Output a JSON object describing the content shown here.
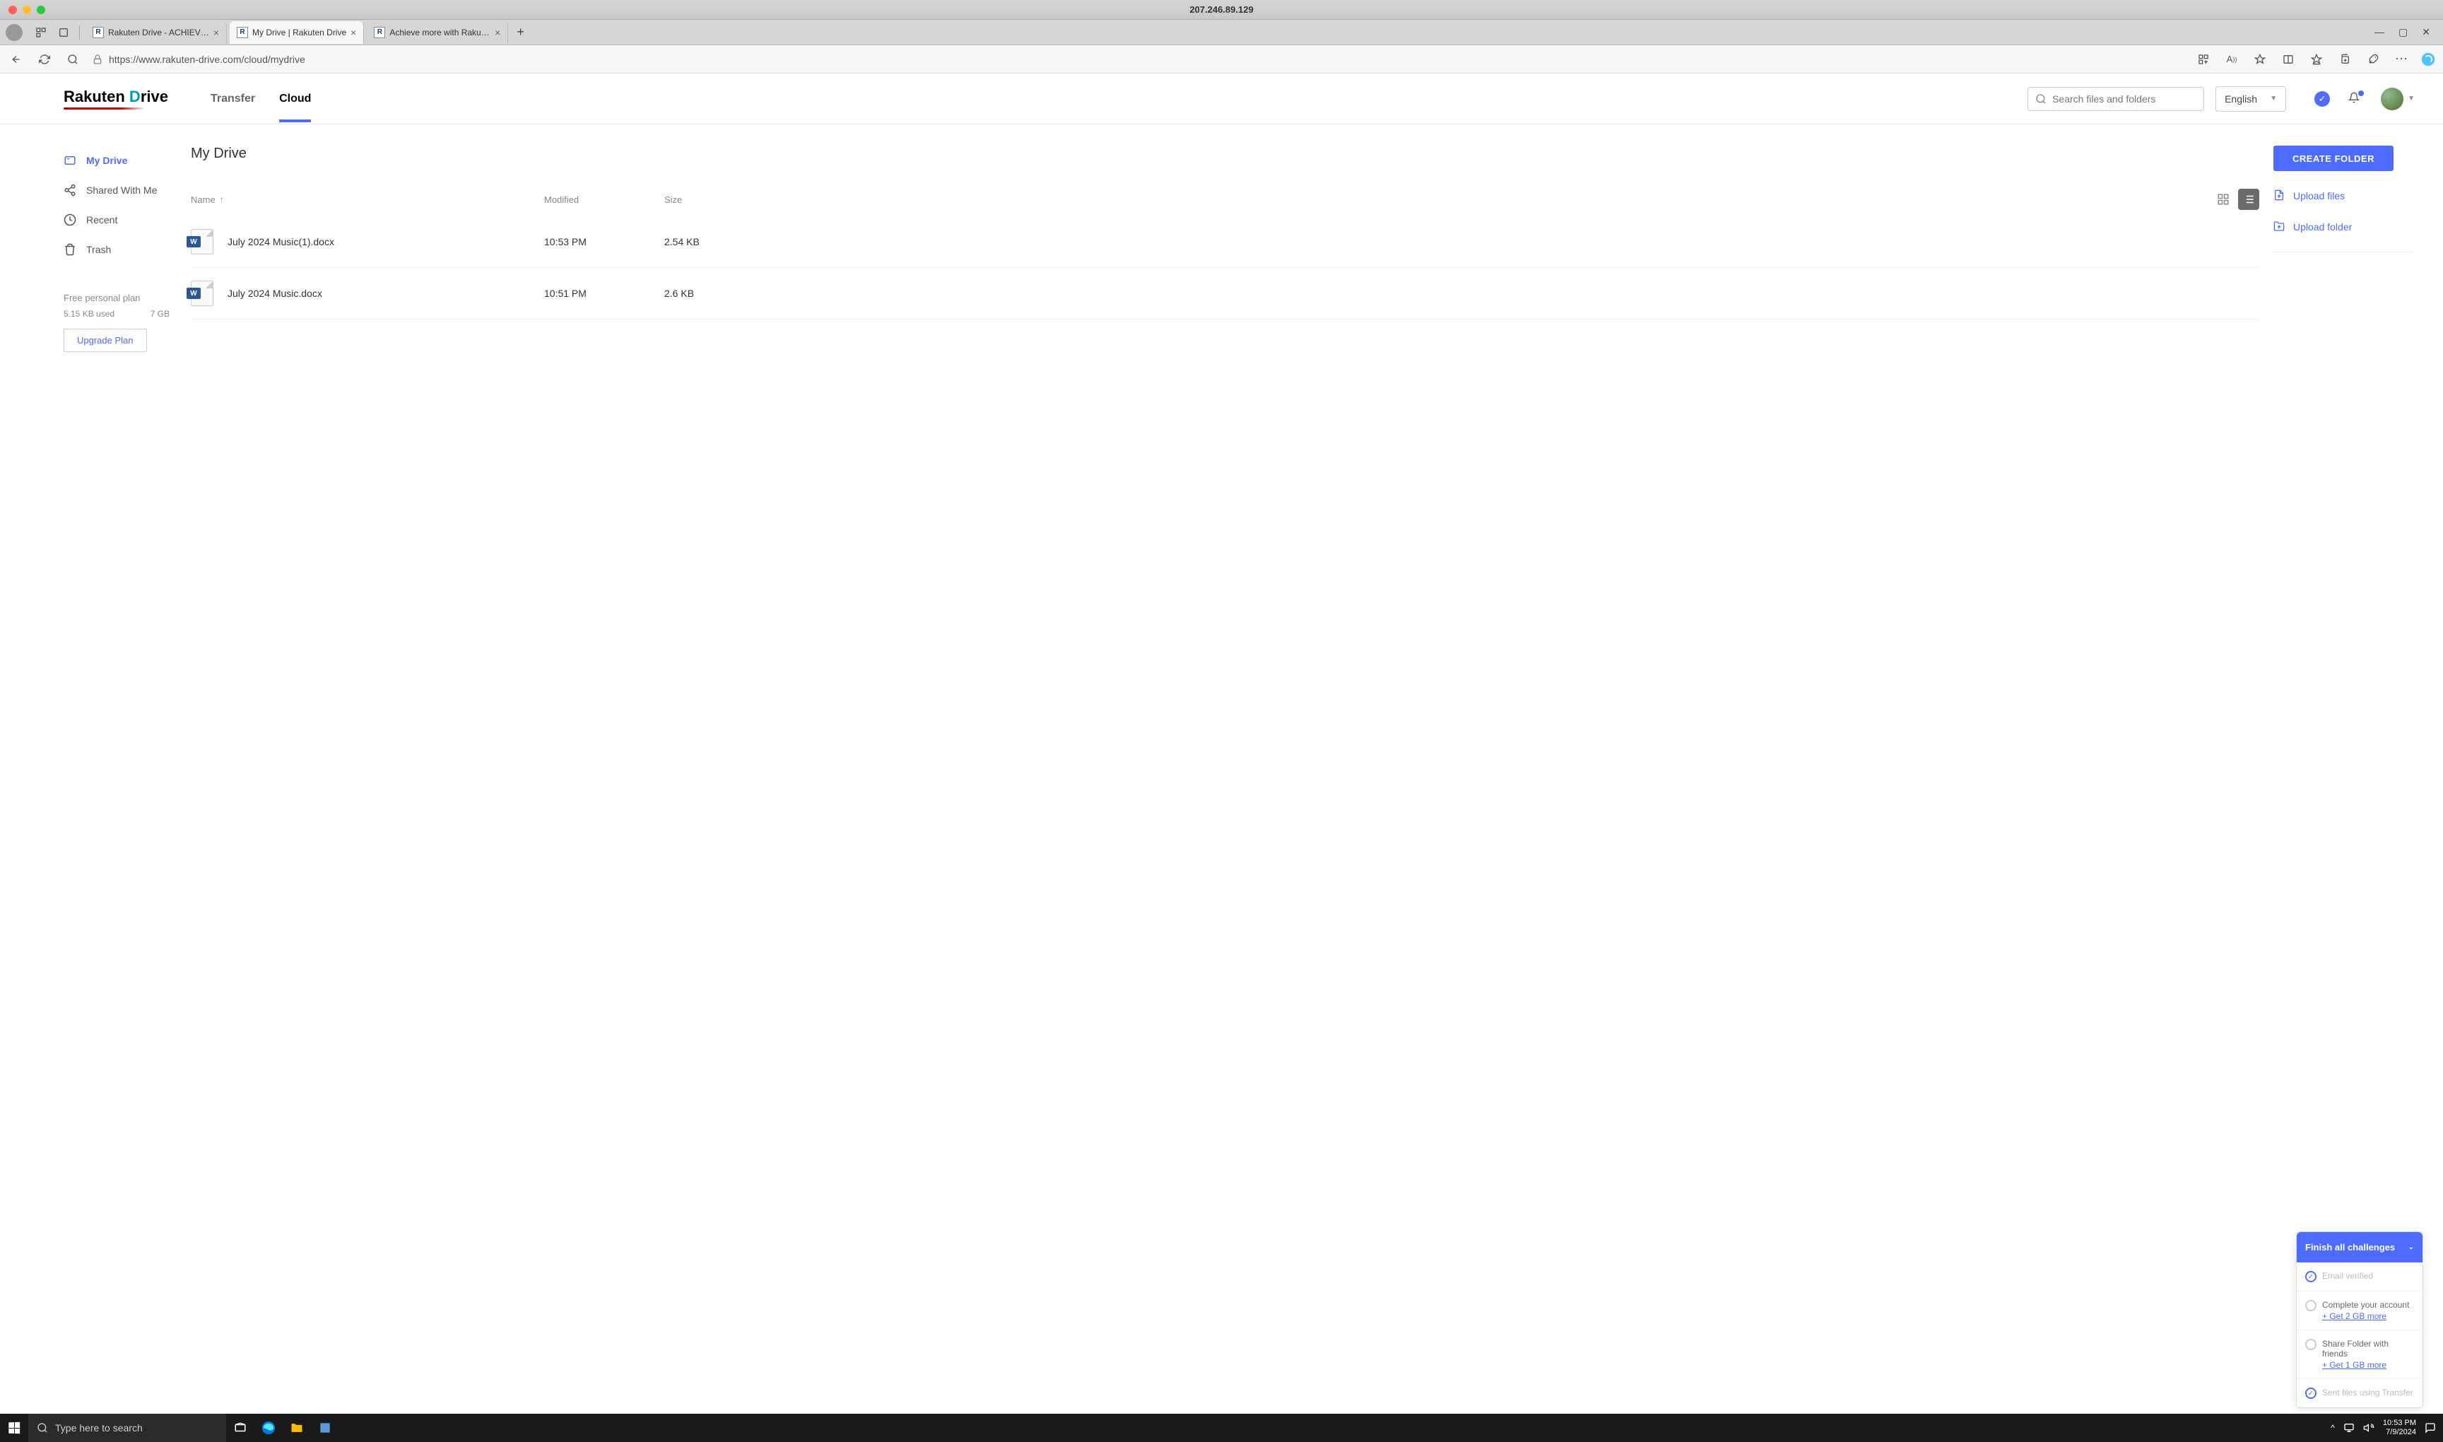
{
  "mac": {
    "title": "207.246.89.129"
  },
  "browser": {
    "tabs": [
      {
        "title": "Rakuten Drive - ACHIEVE MORE"
      },
      {
        "title": "My Drive | Rakuten Drive"
      },
      {
        "title": "Achieve more with Rakuten Driv"
      }
    ],
    "url": "https://www.rakuten-drive.com/cloud/mydrive"
  },
  "header": {
    "logo_rakuten": "Rakuten",
    "logo_drive": "Drive",
    "nav": {
      "transfer": "Transfer",
      "cloud": "Cloud"
    },
    "search_placeholder": "Search files and folders",
    "language": "English"
  },
  "sidebar": {
    "items": {
      "mydrive": "My Drive",
      "shared": "Shared With Me",
      "recent": "Recent",
      "trash": "Trash"
    },
    "plan_label": "Free personal plan",
    "used": "5.15 KB used",
    "total": "7 GB",
    "upgrade": "Upgrade Plan"
  },
  "page": {
    "title": "My Drive",
    "cols": {
      "name": "Name",
      "modified": "Modified",
      "size": "Size"
    },
    "files": [
      {
        "name": "July 2024 Music(1).docx",
        "modified": "10:53 PM",
        "size": "2.54 KB"
      },
      {
        "name": "July 2024 Music.docx",
        "modified": "10:51 PM",
        "size": "2.6 KB"
      }
    ]
  },
  "actions": {
    "create_folder": "CREATE FOLDER",
    "upload_files": "Upload files",
    "upload_folder": "Upload folder"
  },
  "challenges": {
    "title": "Finish all challenges",
    "items": [
      {
        "text": "Email verified",
        "done": true
      },
      {
        "text": "Complete your account",
        "link": "+ Get 2 GB more",
        "done": false
      },
      {
        "text": "Share Folder with friends",
        "link": "+ Get 1 GB more",
        "done": false
      },
      {
        "text": "Sent files using Transfer",
        "done": true
      }
    ]
  },
  "taskbar": {
    "search_placeholder": "Type here to search",
    "time": "10:53 PM",
    "date": "7/9/2024"
  }
}
